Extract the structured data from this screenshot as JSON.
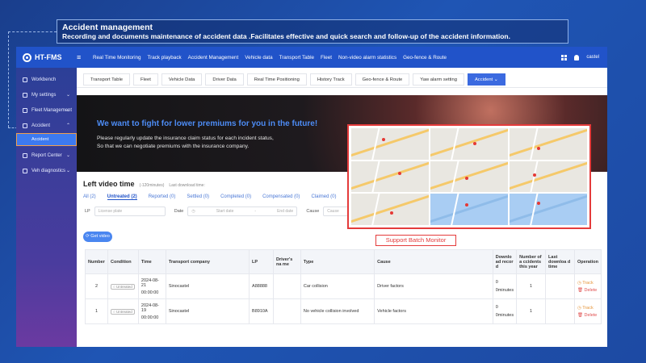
{
  "caption": {
    "title": "Accident management",
    "description": "Recording and documents maintenance of accident data .Facilitates effective and quick search and follow-up of the accident information."
  },
  "topbar": {
    "logo": "HT-FMS",
    "nav": [
      "Real Time Monitoring",
      "Track playback",
      "Accident Management",
      "Vehicle data",
      "Transport Table",
      "Fleet",
      "Non-video alarm statistics",
      "Geo-fence & Route"
    ],
    "user": "castel"
  },
  "sidebar": {
    "items": [
      {
        "label": "Workbench"
      },
      {
        "label": "My settings"
      },
      {
        "label": "Fleet Management"
      },
      {
        "label": "Accident"
      },
      {
        "label": "Report Center"
      },
      {
        "label": "Veh diagnostics"
      }
    ],
    "active_sub": "Accident"
  },
  "tabs": [
    "Transport Table",
    "Fleet",
    "Vehicle Data",
    "Driver Data",
    "Real Time Positioning",
    "History Track",
    "Geo-fence & Route",
    "Yaw alarm setting",
    "Accident"
  ],
  "banner": {
    "title": "We want to fight for lower premiums for you in the future!",
    "line1": "Please regularly update the insurance claim status for each incident status,",
    "line2": "So that we can negotiate premiums with the insurance company."
  },
  "section": {
    "title": "Left video time",
    "subtitle": "(-120minutes)",
    "last_download": "Last download time:",
    "status_tabs": [
      "All (2)",
      "Untreated (2)",
      "Reported (0)",
      "Settled (0)",
      "Completed (0)",
      "Compensated (0)",
      "Claimed (0)"
    ]
  },
  "filters": {
    "lp_label": "LP",
    "lp_placeholder": "License plate",
    "date_label": "Date",
    "start_placeholder": "Start date",
    "end_placeholder": "End date",
    "cause_label": "Cause",
    "cause_placeholder": "Cause"
  },
  "get_video": "Get video",
  "table": {
    "headers": [
      "Number",
      "Condition",
      "Time",
      "Transport company",
      "LP",
      "Driver's na me",
      "Type",
      "Cause",
      "Downlo ad recor d",
      "Number of a ccidents this year",
      "Last downloa d time",
      "Operation"
    ],
    "rows": [
      {
        "number": "2",
        "condition": "Untreated",
        "date": "2024-08-21",
        "clock": "00:00:00",
        "company": "Sinocastel",
        "lp": "A88888",
        "driver": "",
        "type": "Car collision",
        "cause": "Driver factors",
        "dl_count": "0",
        "dl_unit": "0minutes",
        "accidents": "1",
        "last_dl": "",
        "track": "Track",
        "delete": "Delete"
      },
      {
        "number": "1",
        "condition": "Untreated",
        "date": "2024-08-19",
        "clock": "00:00:00",
        "company": "Sinocastel",
        "lp": "B8910A",
        "driver": "",
        "type": "No vehicle collision involved",
        "cause": "Vehicle factors",
        "dl_count": "0",
        "dl_unit": "0minutes",
        "accidents": "1",
        "last_dl": "",
        "track": "Track",
        "delete": "Delete"
      }
    ]
  },
  "support_label": "Support Batch Monitor"
}
